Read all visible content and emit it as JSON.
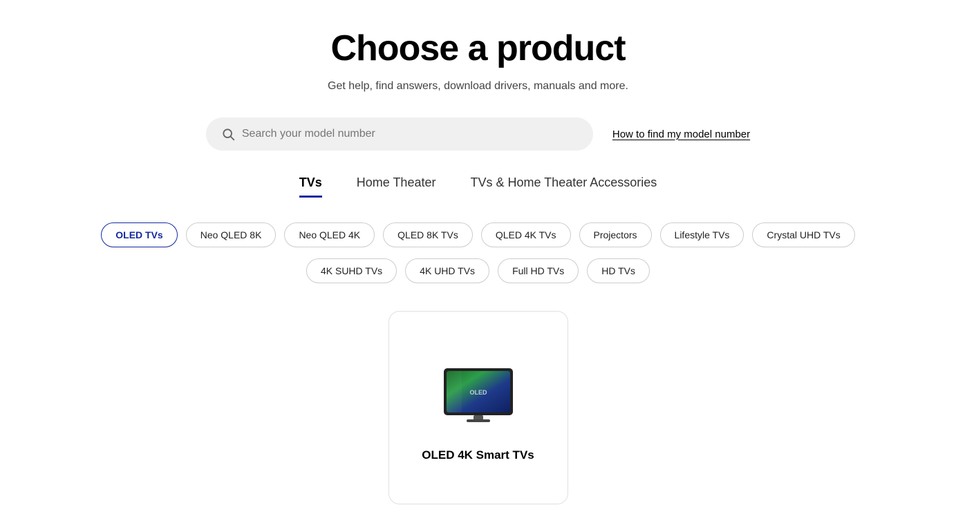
{
  "header": {
    "title": "Choose a product",
    "subtitle": "Get help, find answers, download drivers, manuals and more."
  },
  "search": {
    "placeholder": "Search your model number",
    "model_link": "How to find my model number"
  },
  "tabs": [
    {
      "id": "tvs",
      "label": "TVs",
      "active": true
    },
    {
      "id": "home-theater",
      "label": "Home Theater",
      "active": false
    },
    {
      "id": "accessories",
      "label": "TVs & Home Theater Accessories",
      "active": false
    }
  ],
  "filters_row1": [
    {
      "id": "oled-tvs",
      "label": "OLED TVs",
      "active": true
    },
    {
      "id": "neo-qled-8k",
      "label": "Neo QLED 8K",
      "active": false
    },
    {
      "id": "neo-qled-4k",
      "label": "Neo QLED 4K",
      "active": false
    },
    {
      "id": "qled-8k-tvs",
      "label": "QLED 8K TVs",
      "active": false
    },
    {
      "id": "qled-4k-tvs",
      "label": "QLED 4K TVs",
      "active": false
    },
    {
      "id": "projectors",
      "label": "Projectors",
      "active": false
    },
    {
      "id": "lifestyle-tvs",
      "label": "Lifestyle TVs",
      "active": false
    },
    {
      "id": "crystal-uhd-tvs",
      "label": "Crystal UHD TVs",
      "active": false
    }
  ],
  "filters_row2": [
    {
      "id": "4k-suhd-tvs",
      "label": "4K SUHD TVs",
      "active": false
    },
    {
      "id": "4k-uhd-tvs",
      "label": "4K UHD TVs",
      "active": false
    },
    {
      "id": "full-hd-tvs",
      "label": "Full HD TVs",
      "active": false
    },
    {
      "id": "hd-tvs",
      "label": "HD TVs",
      "active": false
    }
  ],
  "products": [
    {
      "id": "oled-4k-smart-tvs",
      "name": "OLED 4K Smart TVs"
    }
  ],
  "colors": {
    "accent": "#1428A0",
    "chip_border": "#ccc",
    "card_border": "#e0e0e0"
  }
}
